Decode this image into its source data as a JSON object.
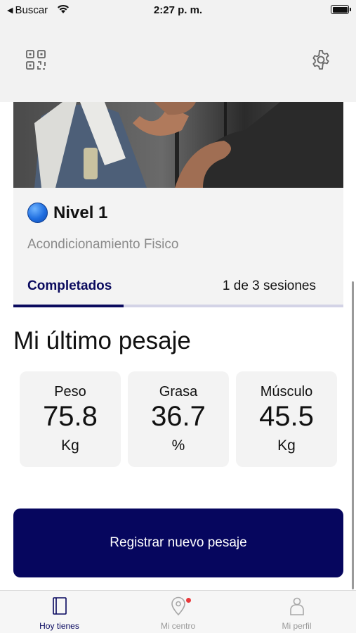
{
  "status_bar": {
    "back_label": "Buscar",
    "time": "2:27 p. m."
  },
  "icons": {
    "top_left": "qr-code-icon",
    "top_right": "gear-icon",
    "tabs": [
      "book-icon",
      "map-pin-icon",
      "person-icon"
    ]
  },
  "card": {
    "level_title": "Nivel 1",
    "subtitle": "Acondicionamiento Fisico",
    "progress_tab": "Completados",
    "progress_count": "1 de 3 sesiones",
    "progress_fraction": 0.333
  },
  "weigh_in": {
    "title": "Mi último pesaje",
    "metrics": [
      {
        "label": "Peso",
        "value": "75.8",
        "unit": "Kg"
      },
      {
        "label": "Grasa",
        "value": "36.7",
        "unit": "%"
      },
      {
        "label": "Músculo",
        "value": "45.5",
        "unit": "Kg"
      }
    ],
    "cta_label": "Registrar nuevo pesaje"
  },
  "tab_bar": {
    "tabs": [
      {
        "label": "Hoy tienes",
        "active": true
      },
      {
        "label": "Mi centro",
        "active": false,
        "badge": true
      },
      {
        "label": "Mi perfil",
        "active": false
      }
    ]
  },
  "colors": {
    "accent": "#06065e",
    "badge": "#e8383a",
    "level_dot": "#1f6ee0"
  }
}
